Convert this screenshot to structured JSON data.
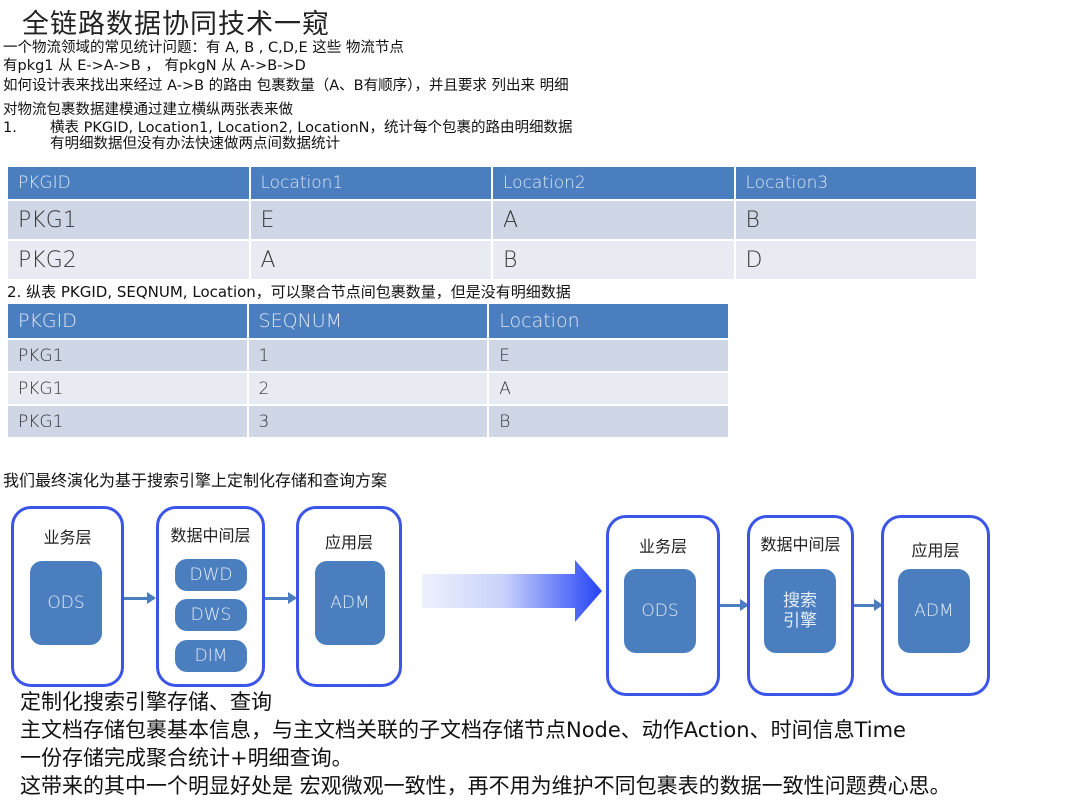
{
  "title": "全链路数据协同技术一窥",
  "intro": {
    "line1": "一个物流领域的常见统计问题：有 A, B , C,D,E 这些 物流节点",
    "line2": "有pkg1 从 E->A->B ， 有pkgN  从 A->B->D",
    "line3": "如何设计表来找出来经过 A->B 的路由 包裹数量（A、B有顺序），并且要求 列出来 明细",
    "line4": "对物流包裹数据建模通过建立横纵两张表来做",
    "line5_num": "1.",
    "line5": "横表 PKGID, Location1, Location2, LocationN，统计每个包裹的路由明细数据",
    "line6": "有明细数据但没有办法快速做两点间数据统计"
  },
  "table1": {
    "headers": [
      "PKGID",
      "Location1",
      "Location2",
      "Location3"
    ],
    "rows": [
      [
        "PKG1",
        "E",
        "A",
        "B"
      ],
      [
        "PKG2",
        "A",
        "B",
        "D"
      ]
    ]
  },
  "table2_caption": "2. 纵表 PKGID, SEQNUM, Location，可以聚合节点间包裹数量，但是没有明细数据",
  "table2": {
    "headers": [
      "PKGID",
      "SEQNUM",
      "Location"
    ],
    "rows": [
      [
        "PKG1",
        "1",
        "E"
      ],
      [
        "PKG1",
        "2",
        "A"
      ],
      [
        "PKG1",
        "3",
        "B"
      ]
    ]
  },
  "evolution_caption": "我们最终演化为基于搜索引擎上定制化存储和查询方案",
  "diagram_before": {
    "layers": [
      {
        "label": "业务层",
        "blocks": [
          "ODS"
        ]
      },
      {
        "label": "数据中间层",
        "blocks": [
          "DWD",
          "DWS",
          "DIM"
        ]
      },
      {
        "label": "应用层",
        "blocks": [
          "ADM"
        ]
      }
    ]
  },
  "diagram_after": {
    "layers": [
      {
        "label": "业务层",
        "blocks": [
          "ODS"
        ]
      },
      {
        "label": "数据中间层",
        "blocks": [
          "搜索\n引擎"
        ]
      },
      {
        "label": "应用层",
        "blocks": [
          "ADM"
        ]
      }
    ]
  },
  "colors": {
    "accent_blue": "#4a7ebf",
    "border_blue": "#3a55e8"
  },
  "bottom": {
    "line1": "定制化搜索引擎存储、查询",
    "line2": "主文档存储包裹基本信息，与主文档关联的子文档存储节点Node、动作Action、时间信息Time",
    "line3": "一份存储完成聚合统计+明细查询。",
    "line4": "这带来的其中一个明显好处是 宏观微观一致性，再不用为维护不同包裹表的数据一致性问题费心思。"
  }
}
